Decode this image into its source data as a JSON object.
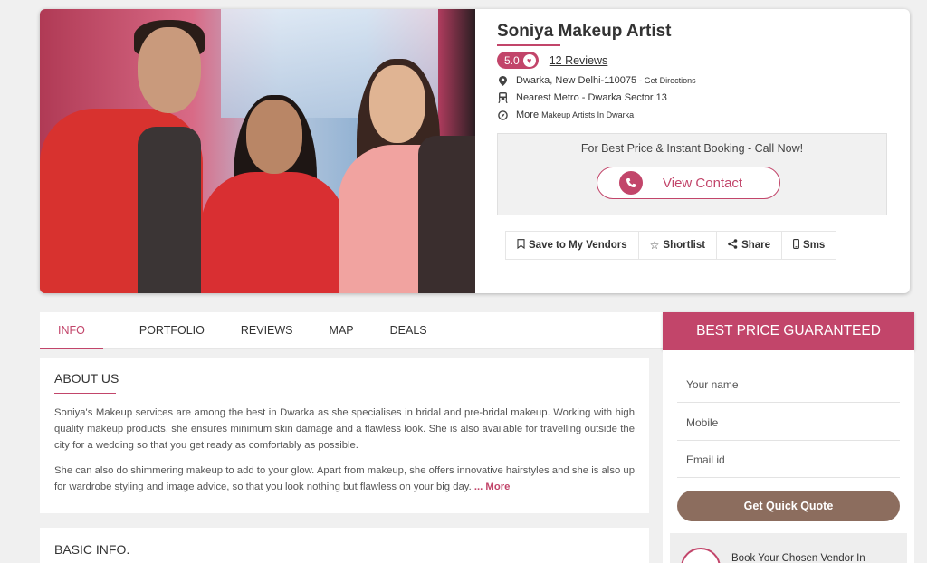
{
  "vendor": {
    "name": "Soniya Makeup Artist",
    "rating": "5.0",
    "reviews": "12 Reviews",
    "address": "Dwarka, New Delhi-110075",
    "directions": "- Get Directions",
    "metro": "Nearest Metro - Dwarka Sector 13",
    "more_label": "More",
    "more_link": "Makeup Artists In Dwarka"
  },
  "booking": {
    "text": "For Best Price & Instant Booking - Call Now!",
    "view_contact": "View Contact"
  },
  "actions": {
    "save": "Save to My Vendors",
    "shortlist": "Shortlist",
    "share": "Share",
    "sms": "Sms"
  },
  "tabs": [
    "INFO",
    "PORTFOLIO",
    "REVIEWS",
    "MAP",
    "DEALS"
  ],
  "about": {
    "title": "ABOUT US",
    "p1": "Soniya's Makeup services are among the best in Dwarka as she specialises in bridal and pre-bridal makeup. Working with high quality makeup products, she ensures minimum skin damage and a flawless look. She is also available for travelling outside the city for a wedding so that you get ready as comfortably as possible.",
    "p2": "She can also do shimmering makeup to add to your glow. Apart from makeup, she offers innovative hairstyles and she is also up for wardrobe styling and image advice, so that you look nothing but flawless on your big day.",
    "more": "... More"
  },
  "basic_info": {
    "title": "BASIC INFO."
  },
  "best_price": {
    "header": "BEST PRICE GUARANTEED",
    "name_placeholder": "Your name",
    "mobile_placeholder": "Mobile",
    "email_placeholder": "Email id",
    "quote_button": "Get Quick Quote",
    "book_text": "Book Your Chosen Vendor In"
  },
  "colors": {
    "accent": "#c2456a",
    "quote_button": "#8c6d5e"
  }
}
